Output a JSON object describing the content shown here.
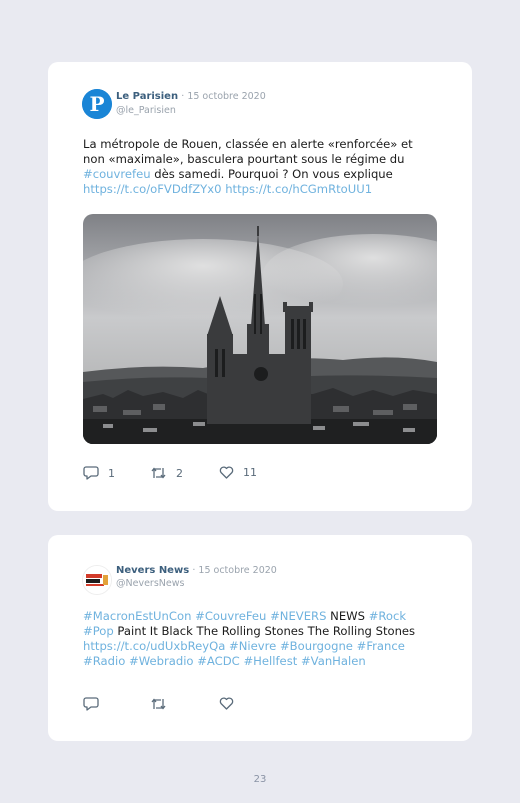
{
  "tweets": [
    {
      "author": "Le Parisien",
      "date": "· 15 octobre 2020",
      "handle": "@le_Parisien",
      "text": [
        {
          "t": "La métropole de Rouen, classée en alerte «renforcée» et non «maximale», basculera pourtant sous le régime du ",
          "link": false
        },
        {
          "t": "#couvrefeu",
          "link": true
        },
        {
          "t": " dès samedi. Pourquoi ? On vous explique ",
          "link": false
        },
        {
          "t": "https://t.co/oFVDdfZYx0",
          "link": true
        },
        {
          "t": " ",
          "link": false
        },
        {
          "t": "https://t.co/hCGmRtoUU1",
          "link": true
        }
      ],
      "replies": "1",
      "retweets": "2",
      "likes": "11",
      "avatar_color": "#1a85d6",
      "avatar_glyph": "P"
    },
    {
      "author": "Nevers News",
      "date": "· 15 octobre 2020",
      "handle": "@NeversNews",
      "text": [
        {
          "t": "#MacronEstUnCon",
          "link": true
        },
        {
          "t": " ",
          "link": false
        },
        {
          "t": "#CouvreFeu",
          "link": true
        },
        {
          "t": " ",
          "link": false
        },
        {
          "t": "#NEVERS",
          "link": true
        },
        {
          "t": " NEWS ",
          "link": false
        },
        {
          "t": "#Rock",
          "link": true
        },
        {
          "t": " ",
          "link": false
        },
        {
          "t": "#Pop",
          "link": true
        },
        {
          "t": " Paint It Black The Rolling Stones The Rolling Stones ",
          "link": false
        },
        {
          "t": "https://t.co/udUxbReyQa",
          "link": true
        },
        {
          "t": " ",
          "link": false
        },
        {
          "t": "#Nievre",
          "link": true
        },
        {
          "t": " ",
          "link": false
        },
        {
          "t": "#Bourgogne",
          "link": true
        },
        {
          "t": " ",
          "link": false
        },
        {
          "t": "#France",
          "link": true
        },
        {
          "t": " ",
          "link": false
        },
        {
          "t": "#Radio",
          "link": true
        },
        {
          "t": " ",
          "link": false
        },
        {
          "t": "#Webradio",
          "link": true
        },
        {
          "t": " ",
          "link": false
        },
        {
          "t": "#ACDC",
          "link": true
        },
        {
          "t": " ",
          "link": false
        },
        {
          "t": "#Hellfest",
          "link": true
        },
        {
          "t": " ",
          "link": false
        },
        {
          "t": "#VanHalen",
          "link": true
        }
      ],
      "replies": "",
      "retweets": "",
      "likes": "",
      "avatar_color": "#d23b2a"
    }
  ],
  "page_number": "23",
  "colors": {
    "link": "#6fb2de",
    "name": "#3c5f7d",
    "meta": "#9aa3ad",
    "background": "#e9eaf1"
  },
  "icons": [
    "reply-icon",
    "retweet-icon",
    "like-icon"
  ]
}
